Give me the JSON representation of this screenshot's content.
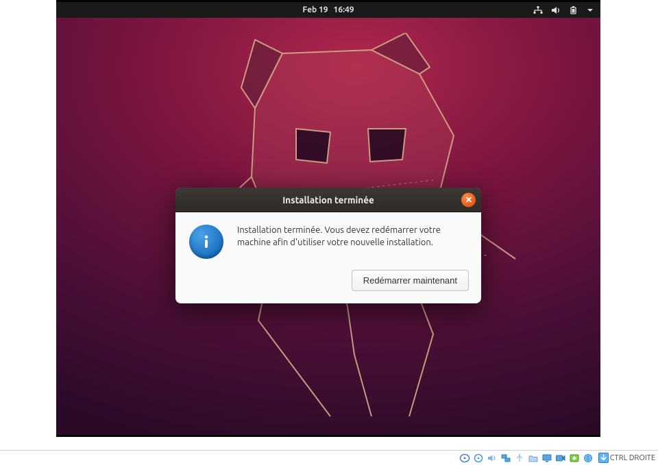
{
  "topbar": {
    "date": "Feb 19",
    "time": "16:49"
  },
  "dialog": {
    "title": "Installation terminée",
    "message": "Installation terminée. Vous devez redémarrer votre machine afin d'utiliser votre nouvelle installation.",
    "restart_label": "Redémarrer maintenant"
  },
  "vb_status": {
    "hostkey": "CTRL DROITE"
  }
}
